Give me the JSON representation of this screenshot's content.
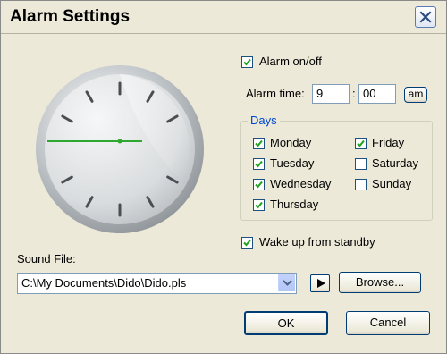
{
  "window": {
    "title": "Alarm Settings"
  },
  "alarm": {
    "onoff_label": "Alarm on/off",
    "onoff_checked": true,
    "time_label": "Alarm time:",
    "hour": "9",
    "separator": ":",
    "minute": "00",
    "ampm": "am"
  },
  "days": {
    "legend": "Days",
    "items": [
      {
        "label": "Monday",
        "checked": true
      },
      {
        "label": "Tuesday",
        "checked": true
      },
      {
        "label": "Wednesday",
        "checked": true
      },
      {
        "label": "Thursday",
        "checked": true
      },
      {
        "label": "Friday",
        "checked": true
      },
      {
        "label": "Saturday",
        "checked": false
      },
      {
        "label": "Sunday",
        "checked": false
      }
    ]
  },
  "standby": {
    "label": "Wake up from standby",
    "checked": true
  },
  "sound": {
    "label": "Sound File:",
    "path": "C:\\My Documents\\Dido\\Dido.pls",
    "browse_label": "Browse..."
  },
  "buttons": {
    "ok": "OK",
    "cancel": "Cancel"
  },
  "colors": {
    "hand": "#2ea82e",
    "accent_text": "#0046d5",
    "face": "#d9dcde"
  },
  "icons": {
    "close": "close-icon",
    "play": "play-icon",
    "dropdown": "chevron-down-icon",
    "check": "check-icon"
  }
}
